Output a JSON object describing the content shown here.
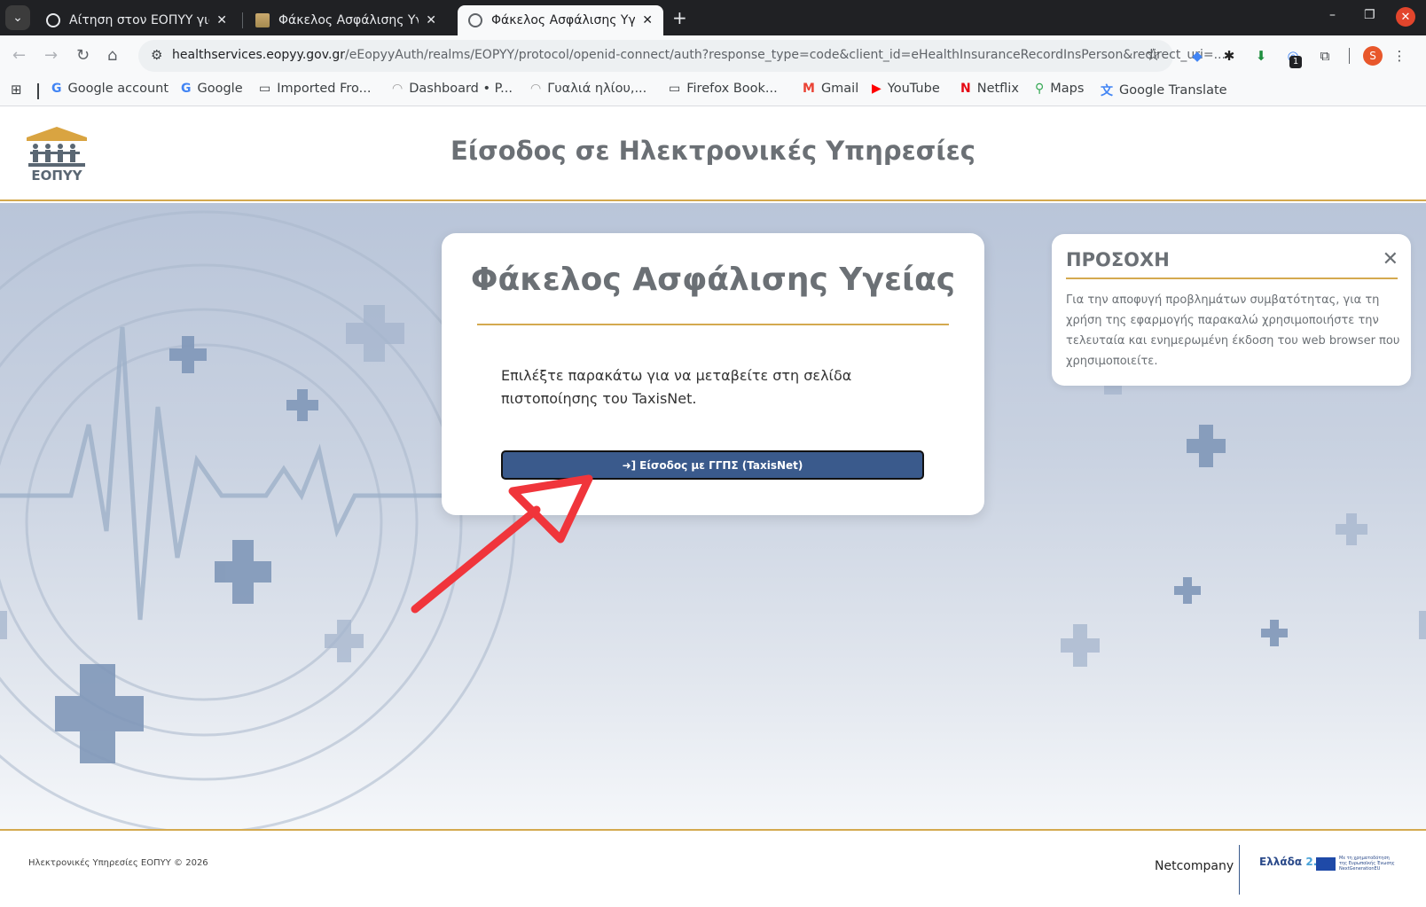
{
  "browser": {
    "tabs": [
      {
        "title": "Αίτηση στον ΕΟΠΥΥ για τ",
        "active": false
      },
      {
        "title": "Φάκελος Ασφάλισης Υγε",
        "active": false
      },
      {
        "title": "Φάκελος Ασφάλισης Υγε",
        "active": true
      }
    ],
    "url_host": "healthservices.eopyy.gov.gr",
    "url_rest": "/eEopyyAuth/realms/EOPYY/protocol/openid-connect/auth?response_type=code&client_id=eHealthInsuranceRecordInsPerson&redirect_uri=...",
    "extension_badge": "1",
    "avatar_letter": "S",
    "bookmarks": [
      {
        "label": "Google account",
        "icon": "google-icon"
      },
      {
        "label": "Google",
        "icon": "google-icon"
      },
      {
        "label": "Imported Fro...",
        "icon": "folder-icon"
      },
      {
        "label": "Dashboard • P...",
        "icon": "sunglasses-icon"
      },
      {
        "label": "Γυαλιά ηλίου,...",
        "icon": "sunglasses-icon"
      },
      {
        "label": "Firefox Book...",
        "icon": "folder-icon"
      },
      {
        "label": "Gmail",
        "icon": "gmail-icon"
      },
      {
        "label": "YouTube",
        "icon": "youtube-icon"
      },
      {
        "label": "Netflix",
        "icon": "netflix-icon"
      },
      {
        "label": "Maps",
        "icon": "maps-icon"
      },
      {
        "label": "Google Translate",
        "icon": "translate-icon"
      }
    ]
  },
  "header": {
    "logo_text": "ΕΟΠΥΥ",
    "title": "Είσοδος σε Ηλεκτρονικές Υπηρεσίες"
  },
  "card": {
    "title": "Φάκελος Ασφάλισης Υγείας",
    "text": "Επιλέξτε παρακάτω για να μεταβείτε στη σελίδα πιστοποίησης του TaxisNet.",
    "button_label": "Είσοδος με ΓΓΠΣ (TaxisNet)"
  },
  "notice": {
    "title": "ΠΡΟΣΟΧΗ",
    "text": "Για την αποφυγή προβλημάτων συμβατότητας, για τη χρήση της εφαρμογής παρακαλώ χρησιμοποιήστε την τελευταία και ενημερωμένη έκδοση του web browser που χρησιμοποιείτε."
  },
  "footer": {
    "copyright": "Ηλεκτρονικές Υπηρεσίες ΕΟΠΥΥ  © 2026",
    "partner": "Netcompany",
    "greece_label": "Ελλάδα",
    "greece_version": "2.0",
    "eu_text": "Με τη χρηματοδότηση της Ευρωπαϊκής Ένωσης NextGenerationEU"
  },
  "colors": {
    "accent_gold": "#d4a94f",
    "button_blue": "#3a5a8c",
    "title_gray": "#6b7075",
    "arrow_red": "#f0353b"
  }
}
